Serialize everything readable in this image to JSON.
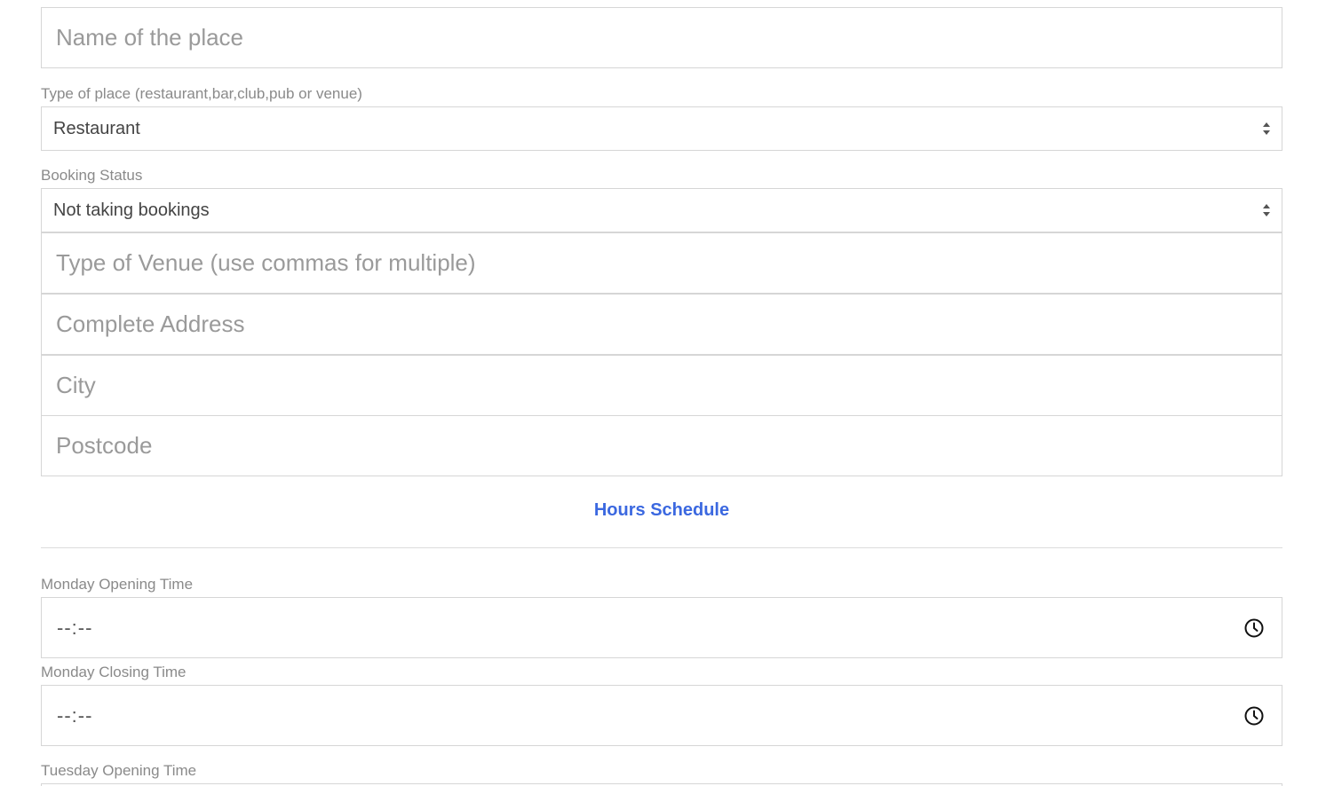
{
  "form": {
    "name_placeholder": "Name of the place",
    "type_label": "Type of place (restaurant,bar,club,pub or venue)",
    "type_value": "Restaurant",
    "booking_label": "Booking Status",
    "booking_value": "Not taking bookings",
    "venue_placeholder": "Type of Venue (use commas for multiple)",
    "address_placeholder": "Complete Address",
    "city_placeholder": "City",
    "postcode_placeholder": "Postcode"
  },
  "hours": {
    "section_title": "Hours Schedule",
    "monday_open_label": "Monday Opening Time",
    "monday_open_value": "--:--",
    "monday_close_label": "Monday Closing Time",
    "monday_close_value": "--:--",
    "tuesday_open_label": "Tuesday Opening Time"
  },
  "icons": {
    "select": "select-arrows-icon",
    "time": "clock-icon"
  },
  "colors": {
    "accent": "#3b68e0",
    "border": "#d6d6d6",
    "placeholder": "#9a9a9a",
    "label": "#8a8a8a"
  }
}
